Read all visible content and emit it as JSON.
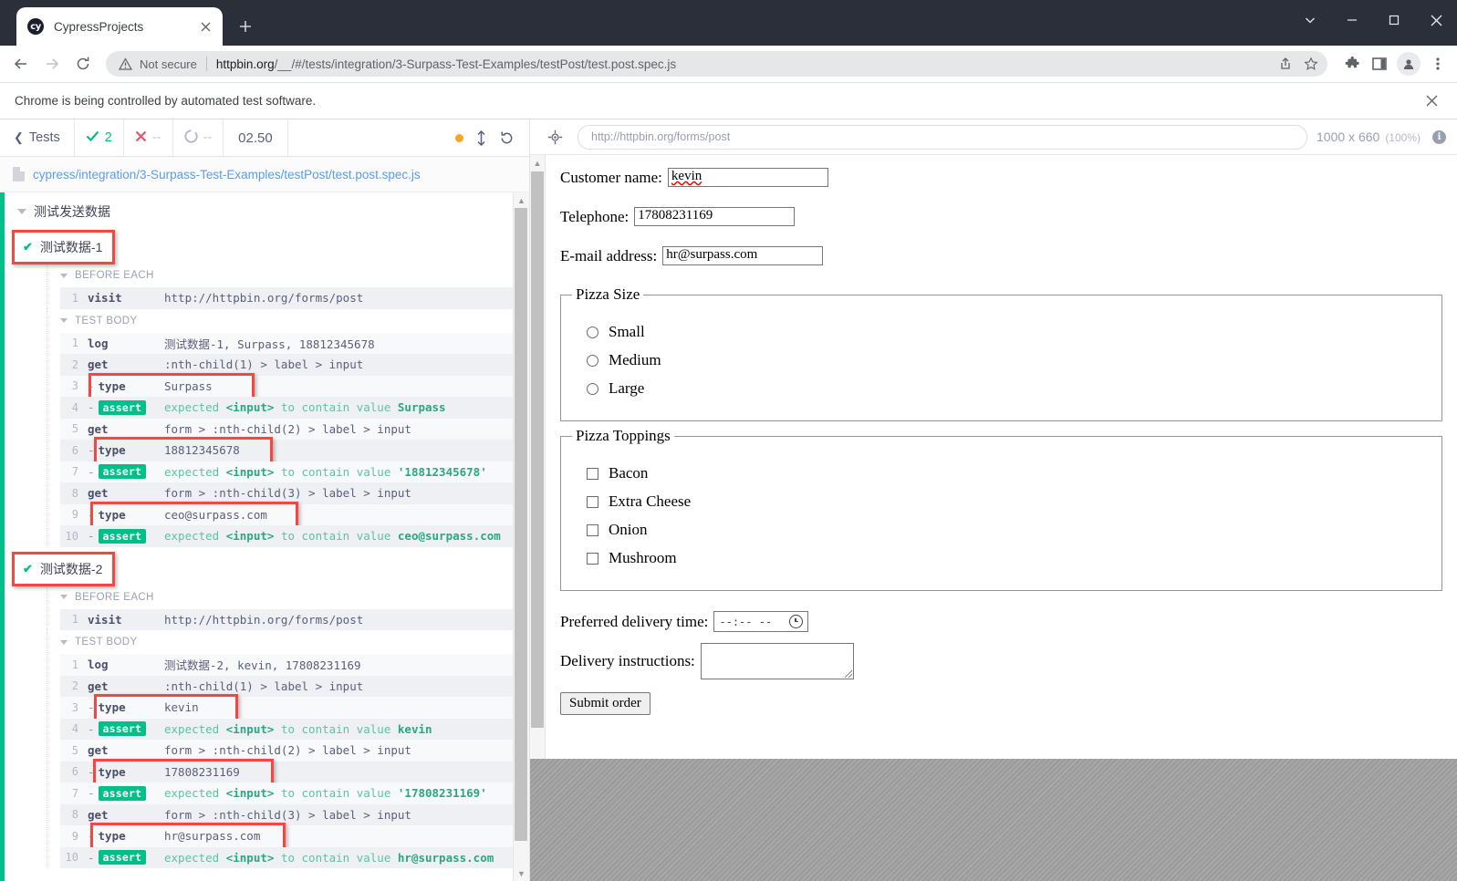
{
  "browser": {
    "tab": {
      "title": "CypressProjects",
      "favicon_text": "cy",
      "close_icon": "close-icon",
      "newtab_icon": "plus-icon"
    },
    "window_controls": {
      "minimize": "minimize-icon",
      "maximize": "maximize-icon",
      "close": "close-icon",
      "more": "chevron-down-icon"
    },
    "nav": {
      "back": "back-arrow-icon",
      "forward": "forward-arrow-icon",
      "reload": "reload-icon"
    },
    "omnibox": {
      "security_label": "Not secure",
      "security_icon": "warning-triangle-icon",
      "url_domain": "httpbin.org",
      "url_path": "/__/#/tests/integration/3-Surpass-Test-Examples/testPost/test.post.spec.js",
      "share_icon": "share-icon",
      "bookmark_icon": "star-icon"
    },
    "toolbar": {
      "extensions": "puzzle-icon",
      "sidepanel": "side-panel-icon",
      "profile": "avatar-icon",
      "menu": "three-dot-menu-icon"
    },
    "infobar": {
      "message": "Chrome is being controlled by automated test software.",
      "close": "close-icon"
    }
  },
  "reporter": {
    "back_label": "Tests",
    "stats": {
      "passed": "2",
      "failed": "--",
      "pending": "--",
      "duration": "02.50"
    },
    "controls": {
      "status_dot": "amber-dot-icon",
      "resize": "vertical-resize-icon",
      "restart": "restart-icon"
    },
    "spec_path": "cypress/integration/3-Surpass-Test-Examples/testPost/test.post.spec.js",
    "suite": "测试发送数据",
    "tests": [
      {
        "name": "测试数据-1",
        "highlighted": true,
        "hooks": [
          {
            "label": "BEFORE EACH",
            "commands": [
              {
                "num": "1",
                "name": "visit",
                "prefix": "",
                "message": "http://httpbin.org/forms/post",
                "type": "normal",
                "highlighted": false
              }
            ]
          },
          {
            "label": "TEST BODY",
            "commands": [
              {
                "num": "1",
                "name": "log",
                "prefix": "",
                "message": "测试数据-1, Surpass, 18812345678",
                "type": "normal",
                "highlighted": false
              },
              {
                "num": "2",
                "name": "get",
                "prefix": "",
                "message": ":nth-child(1) > label > input",
                "type": "normal",
                "highlighted": false
              },
              {
                "num": "3",
                "name": "type",
                "prefix": "-",
                "message": "Surpass",
                "type": "normal",
                "highlighted": true
              },
              {
                "num": "4",
                "name": "assert",
                "prefix": "-",
                "message": "expected <input> to contain value Surpass",
                "type": "assert",
                "highlighted": false
              },
              {
                "num": "5",
                "name": "get",
                "prefix": "",
                "message": "form > :nth-child(2) > label > input",
                "type": "normal",
                "highlighted": false
              },
              {
                "num": "6",
                "name": "type",
                "prefix": "-",
                "message": "18812345678",
                "type": "normal",
                "highlighted": true
              },
              {
                "num": "7",
                "name": "assert",
                "prefix": "-",
                "message": "expected <input> to contain value '18812345678'",
                "type": "assert",
                "highlighted": false
              },
              {
                "num": "8",
                "name": "get",
                "prefix": "",
                "message": "form > :nth-child(3) > label > input",
                "type": "normal",
                "highlighted": false
              },
              {
                "num": "9",
                "name": "type",
                "prefix": "-",
                "message": "ceo@surpass.com",
                "type": "normal",
                "highlighted": true
              },
              {
                "num": "10",
                "name": "assert",
                "prefix": "-",
                "message": "expected <input> to contain value ceo@surpass.com",
                "type": "assert",
                "highlighted": false
              }
            ]
          }
        ]
      },
      {
        "name": "测试数据-2",
        "highlighted": true,
        "hooks": [
          {
            "label": "BEFORE EACH",
            "commands": [
              {
                "num": "1",
                "name": "visit",
                "prefix": "",
                "message": "http://httpbin.org/forms/post",
                "type": "normal",
                "highlighted": false
              }
            ]
          },
          {
            "label": "TEST BODY",
            "commands": [
              {
                "num": "1",
                "name": "log",
                "prefix": "",
                "message": "测试数据-2, kevin, 17808231169",
                "type": "normal",
                "highlighted": false
              },
              {
                "num": "2",
                "name": "get",
                "prefix": "",
                "message": ":nth-child(1) > label > input",
                "type": "normal",
                "highlighted": false
              },
              {
                "num": "3",
                "name": "type",
                "prefix": "-",
                "message": "kevin",
                "type": "normal",
                "highlighted": true
              },
              {
                "num": "4",
                "name": "assert",
                "prefix": "-",
                "message": "expected <input> to contain value kevin",
                "type": "assert",
                "highlighted": false
              },
              {
                "num": "5",
                "name": "get",
                "prefix": "",
                "message": "form > :nth-child(2) > label > input",
                "type": "normal",
                "highlighted": false
              },
              {
                "num": "6",
                "name": "type",
                "prefix": "-",
                "message": "17808231169",
                "type": "normal",
                "highlighted": true
              },
              {
                "num": "7",
                "name": "assert",
                "prefix": "-",
                "message": "expected <input> to contain value '17808231169'",
                "type": "assert",
                "highlighted": false
              },
              {
                "num": "8",
                "name": "get",
                "prefix": "",
                "message": "form > :nth-child(3) > label > input",
                "type": "normal",
                "highlighted": false
              },
              {
                "num": "9",
                "name": "type",
                "prefix": "-",
                "message": "hr@surpass.com",
                "type": "normal",
                "highlighted": true
              },
              {
                "num": "10",
                "name": "assert",
                "prefix": "-",
                "message": "expected <input> to contain value hr@surpass.com",
                "type": "assert",
                "highlighted": false
              }
            ]
          }
        ]
      }
    ]
  },
  "aut": {
    "selector_icon": "selector-playground-icon",
    "url": "http://httpbin.org/forms/post",
    "viewport": "1000 x 660",
    "scale": "(100%)",
    "info_icon": "info-icon",
    "form": {
      "customer_name": {
        "label": "Customer name:",
        "value": "kevin"
      },
      "telephone": {
        "label": "Telephone:",
        "value": "17808231169"
      },
      "email": {
        "label": "E-mail address:",
        "value": "hr@surpass.com"
      },
      "pizza_size": {
        "legend": "Pizza Size",
        "options": [
          "Small",
          "Medium",
          "Large"
        ]
      },
      "pizza_toppings": {
        "legend": "Pizza Toppings",
        "options": [
          "Bacon",
          "Extra Cheese",
          "Onion",
          "Mushroom"
        ]
      },
      "delivery_time": {
        "label": "Preferred delivery time:",
        "value": "--:--  --",
        "icon": "clock-icon"
      },
      "delivery_instructions": {
        "label": "Delivery instructions:",
        "value": ""
      },
      "submit_label": "Submit order"
    }
  },
  "colors": {
    "chrome_dark": "#2b2f3a",
    "pass_green": "#00bf88",
    "fail_red": "#e45770",
    "highlight_red": "#f5463f",
    "link_blue": "#5a9bf0",
    "amber": "#f5a623"
  }
}
